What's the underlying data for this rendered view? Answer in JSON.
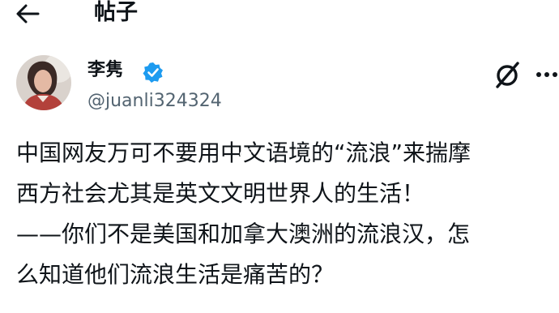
{
  "header": {
    "back_icon": "arrow-left-icon",
    "title": "帖子"
  },
  "post": {
    "author": {
      "display_name": "李隽",
      "handle": "@juanli324324",
      "verified": true,
      "verified_color": "#1d9bf0"
    },
    "actions": {
      "grok_icon": "grok-icon",
      "more_icon": "more-dots-icon"
    },
    "lines": [
      "中国网友万可不要用中文语境的“流浪”来揣摩",
      "西方社会尤其是英文文明世界人的生活！",
      "——你们不是美国和加拿大澳洲的流浪汉，怎",
      "么知道他们流浪生活是痛苦的？"
    ]
  },
  "colors": {
    "text": "#0f1419",
    "secondary": "#536471",
    "accent": "#1d9bf0"
  }
}
